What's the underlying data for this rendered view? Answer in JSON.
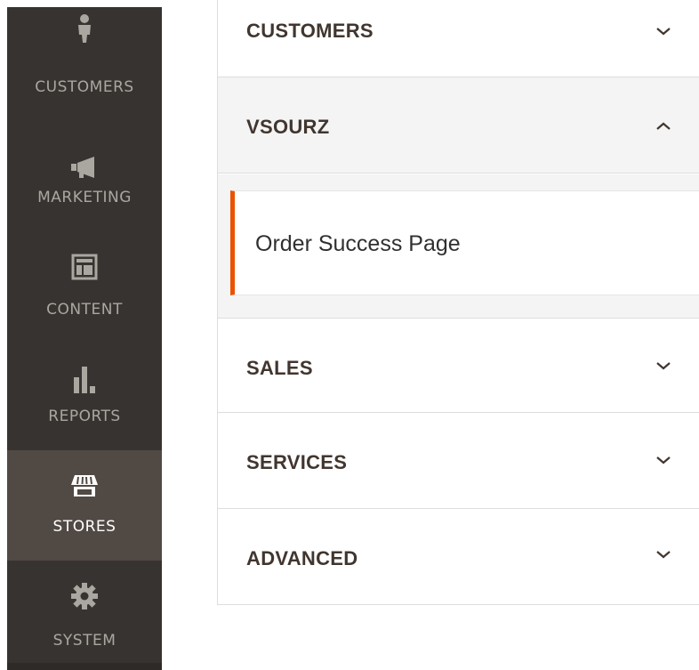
{
  "sidebar": {
    "items": [
      {
        "label": "CUSTOMERS",
        "icon": "customer-icon",
        "active": false
      },
      {
        "label": "MARKETING",
        "icon": "megaphone-icon",
        "active": false
      },
      {
        "label": "CONTENT",
        "icon": "content-layout-icon",
        "active": false
      },
      {
        "label": "REPORTS",
        "icon": "bar-chart-icon",
        "active": false
      },
      {
        "label": "STORES",
        "icon": "storefront-icon",
        "active": true
      },
      {
        "label": "SYSTEM",
        "icon": "gear-icon",
        "active": false
      }
    ]
  },
  "config_tabs": {
    "sections": [
      {
        "title": "CUSTOMERS",
        "expanded": false
      },
      {
        "title": "VSOURZ",
        "expanded": true,
        "items": [
          {
            "label": "Order Success Page",
            "active": true
          }
        ]
      },
      {
        "title": "SALES",
        "expanded": false
      },
      {
        "title": "SERVICES",
        "expanded": false
      },
      {
        "title": "ADVANCED",
        "expanded": false
      }
    ]
  },
  "colors": {
    "nav_background": "#373330",
    "nav_active_background": "#514943",
    "nav_text": "#aaa6a0",
    "accent_orange": "#eb5202",
    "section_title": "#41362f",
    "expanded_background": "#f4f4f4"
  }
}
